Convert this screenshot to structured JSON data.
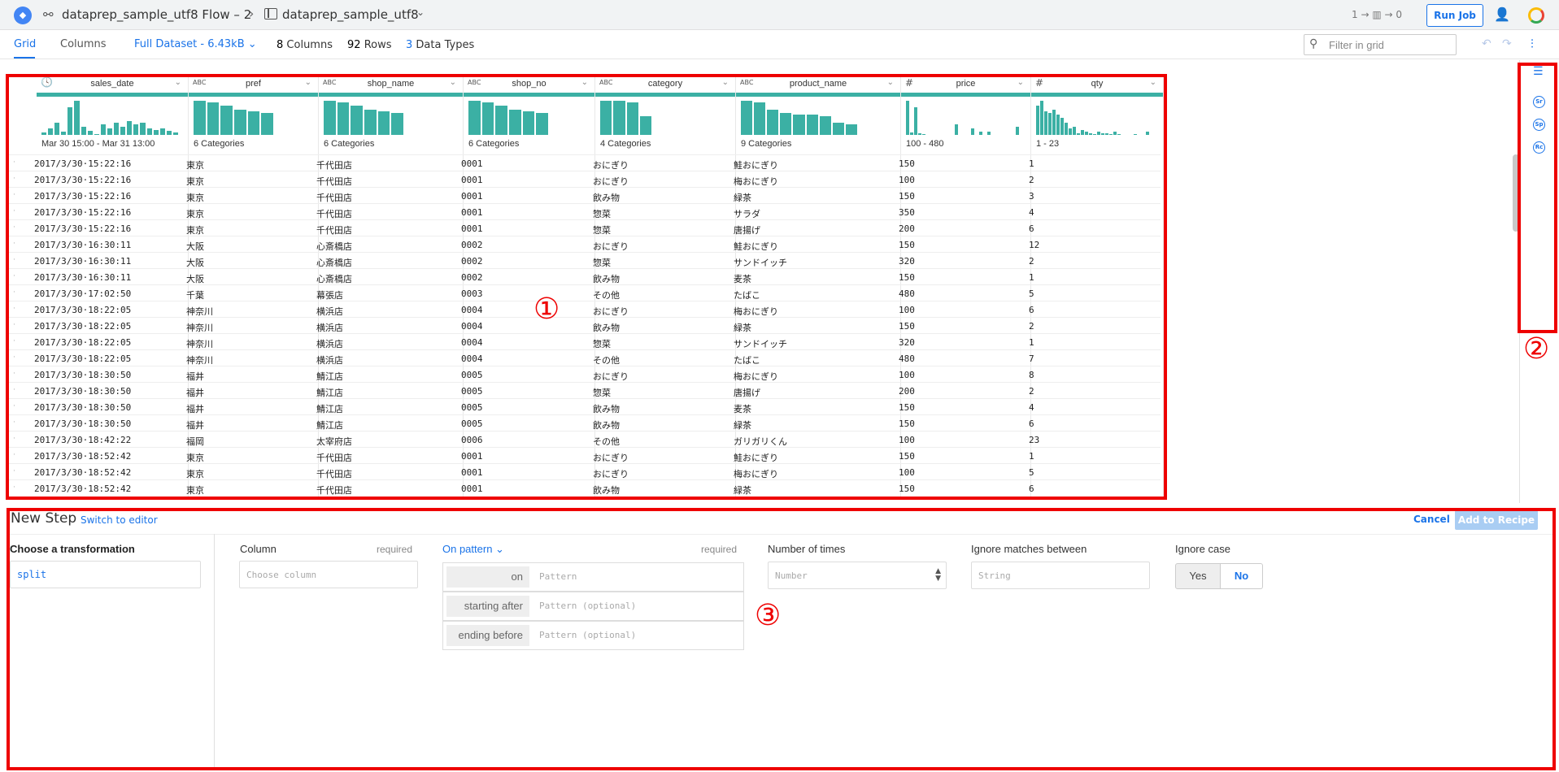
{
  "topbar": {
    "logo_icon": "dataprep-logo-icon",
    "flow_name": "dataprep_sample_utf8 Flow – 2",
    "breadcrumb_sep": "›",
    "dataset_name": "dataprep_sample_utf8",
    "job_flow_text": "1 → ▥ → 0",
    "run_job_label": "Run Job"
  },
  "subbar": {
    "tabs": [
      {
        "label": "Grid"
      },
      {
        "label": "Columns"
      }
    ],
    "dataset_size": "Full Dataset - 6.43kB",
    "columns_count": "8",
    "columns_label": "Columns",
    "rows_count": "92",
    "rows_label": "Rows",
    "types_count": "3",
    "types_label": "Data Types",
    "filter_placeholder": "Filter in grid"
  },
  "grid": {
    "columns": [
      {
        "name": "sales_date",
        "type": "datetime",
        "type_label": "🕓",
        "summary": "Mar 30 15:00 - Mar 31 13:00",
        "hist": [
          0.08,
          0.2,
          0.35,
          0.1,
          0.8,
          1.0,
          0.25,
          0.12,
          0.02,
          0.3,
          0.2,
          0.35,
          0.25,
          0.4,
          0.3,
          0.35,
          0.2,
          0.15,
          0.2,
          0.12,
          0.08
        ]
      },
      {
        "name": "pref",
        "type": "string",
        "type_label": "ABC",
        "summary": "6 Categories",
        "hist": [
          1.0,
          0.95,
          0.85,
          0.75,
          0.7,
          0.65
        ]
      },
      {
        "name": "shop_name",
        "type": "string",
        "type_label": "ABC",
        "summary": "6 Categories",
        "hist": [
          1.0,
          0.95,
          0.85,
          0.75,
          0.7,
          0.65
        ]
      },
      {
        "name": "shop_no",
        "type": "string",
        "type_label": "ABC",
        "summary": "6 Categories",
        "hist": [
          1.0,
          0.95,
          0.85,
          0.75,
          0.7,
          0.65
        ]
      },
      {
        "name": "category",
        "type": "string",
        "type_label": "ABC",
        "summary": "4 Categories",
        "hist": [
          1.0,
          1.0,
          0.95,
          0.55
        ]
      },
      {
        "name": "product_name",
        "type": "string",
        "type_label": "ABC",
        "summary": "9 Categories",
        "hist": [
          1.0,
          0.95,
          0.75,
          0.65,
          0.6,
          0.6,
          0.55,
          0.35,
          0.3
        ]
      },
      {
        "name": "price",
        "type": "number",
        "type_label": "#",
        "summary": "100 - 480",
        "hist": [
          1.0,
          0.08,
          0.8,
          0.05,
          0.02,
          0.0,
          0.0,
          0.0,
          0.0,
          0.0,
          0.0,
          0.0,
          0.3,
          0.0,
          0.0,
          0.0,
          0.2,
          0.0,
          0.1,
          0.0,
          0.1,
          0.0,
          0.0,
          0.0,
          0.0,
          0.0,
          0.0,
          0.25
        ]
      },
      {
        "name": "qty",
        "type": "number",
        "type_label": "#",
        "summary": "1 - 23",
        "hist": [
          0.85,
          1.0,
          0.7,
          0.65,
          0.75,
          0.6,
          0.5,
          0.35,
          0.2,
          0.25,
          0.05,
          0.15,
          0.1,
          0.05,
          0.02,
          0.1,
          0.05,
          0.05,
          0.02,
          0.1,
          0.02,
          0.0,
          0.0,
          0.0,
          0.02,
          0.0,
          0.0,
          0.1
        ]
      }
    ],
    "rows": [
      [
        "2017/3/30·15:22:16",
        "東京",
        "千代田店",
        "0001",
        "おにぎり",
        "鮭おにぎり",
        "150",
        "1"
      ],
      [
        "2017/3/30·15:22:16",
        "東京",
        "千代田店",
        "0001",
        "おにぎり",
        "梅おにぎり",
        "100",
        "2"
      ],
      [
        "2017/3/30·15:22:16",
        "東京",
        "千代田店",
        "0001",
        "飲み物",
        "緑茶",
        "150",
        "3"
      ],
      [
        "2017/3/30·15:22:16",
        "東京",
        "千代田店",
        "0001",
        "惣菜",
        "サラダ",
        "350",
        "4"
      ],
      [
        "2017/3/30·15:22:16",
        "東京",
        "千代田店",
        "0001",
        "惣菜",
        "唐揚げ",
        "200",
        "6"
      ],
      [
        "2017/3/30·16:30:11",
        "大阪",
        "心斎橋店",
        "0002",
        "おにぎり",
        "鮭おにぎり",
        "150",
        "12"
      ],
      [
        "2017/3/30·16:30:11",
        "大阪",
        "心斎橋店",
        "0002",
        "惣菜",
        "サンドイッチ",
        "320",
        "2"
      ],
      [
        "2017/3/30·16:30:11",
        "大阪",
        "心斎橋店",
        "0002",
        "飲み物",
        "麦茶",
        "150",
        "1"
      ],
      [
        "2017/3/30·17:02:50",
        "千葉",
        "幕張店",
        "0003",
        "その他",
        "たばこ",
        "480",
        "5"
      ],
      [
        "2017/3/30·18:22:05",
        "神奈川",
        "横浜店",
        "0004",
        "おにぎり",
        "梅おにぎり",
        "100",
        "6"
      ],
      [
        "2017/3/30·18:22:05",
        "神奈川",
        "横浜店",
        "0004",
        "飲み物",
        "緑茶",
        "150",
        "2"
      ],
      [
        "2017/3/30·18:22:05",
        "神奈川",
        "横浜店",
        "0004",
        "惣菜",
        "サンドイッチ",
        "320",
        "1"
      ],
      [
        "2017/3/30·18:22:05",
        "神奈川",
        "横浜店",
        "0004",
        "その他",
        "たばこ",
        "480",
        "7"
      ],
      [
        "2017/3/30·18:30:50",
        "福井",
        "鯖江店",
        "0005",
        "おにぎり",
        "梅おにぎり",
        "100",
        "8"
      ],
      [
        "2017/3/30·18:30:50",
        "福井",
        "鯖江店",
        "0005",
        "惣菜",
        "唐揚げ",
        "200",
        "2"
      ],
      [
        "2017/3/30·18:30:50",
        "福井",
        "鯖江店",
        "0005",
        "飲み物",
        "麦茶",
        "150",
        "4"
      ],
      [
        "2017/3/30·18:30:50",
        "福井",
        "鯖江店",
        "0005",
        "飲み物",
        "緑茶",
        "150",
        "6"
      ],
      [
        "2017/3/30·18:42:22",
        "福岡",
        "太宰府店",
        "0006",
        "その他",
        "ガリガリくん",
        "100",
        "23"
      ],
      [
        "2017/3/30·18:52:42",
        "東京",
        "千代田店",
        "0001",
        "おにぎり",
        "鮭おにぎり",
        "150",
        "1"
      ],
      [
        "2017/3/30·18:52:42",
        "東京",
        "千代田店",
        "0001",
        "おにぎり",
        "梅おにぎり",
        "100",
        "5"
      ],
      [
        "2017/3/30·18:52:42",
        "東京",
        "千代田店",
        "0001",
        "飲み物",
        "緑茶",
        "150",
        "6"
      ]
    ],
    "row_marker": "·",
    "annotation_mark": "①"
  },
  "rightpanel": {
    "icons": [
      "recipe-icon",
      "sr-suggestion-icon",
      "sp-suggestion-icon",
      "rc-suggestion-icon"
    ],
    "icon_labels": [
      "Sr",
      "Sp",
      "Rc"
    ],
    "annotation_mark": "②"
  },
  "newstep": {
    "title": "New Step",
    "switch_label": "Switch to editor",
    "cancel_label": "Cancel",
    "add_label": "Add to Recipe",
    "transformation_label": "Choose a transformation",
    "transformation_value": "split",
    "column_label": "Column",
    "column_required": "required",
    "column_placeholder": "Choose column",
    "on_pattern_label": "On pattern",
    "on_pattern_required": "required",
    "pattern_rows": [
      {
        "tag": "on",
        "placeholder": "Pattern"
      },
      {
        "tag": "starting after",
        "placeholder": "Pattern (optional)"
      },
      {
        "tag": "ending before",
        "placeholder": "Pattern (optional)"
      }
    ],
    "times_label": "Number of times",
    "times_placeholder": "Number",
    "ignore_between_label": "Ignore matches between",
    "ignore_between_placeholder": "String",
    "ignore_case_label": "Ignore case",
    "ignore_case_yes": "Yes",
    "ignore_case_no": "No",
    "ignore_case_selected": "No",
    "annotation_mark": "③"
  },
  "colors": {
    "accent": "#1a73e8",
    "histogram": "#3bb0a4",
    "annotation": "#ee0000"
  }
}
